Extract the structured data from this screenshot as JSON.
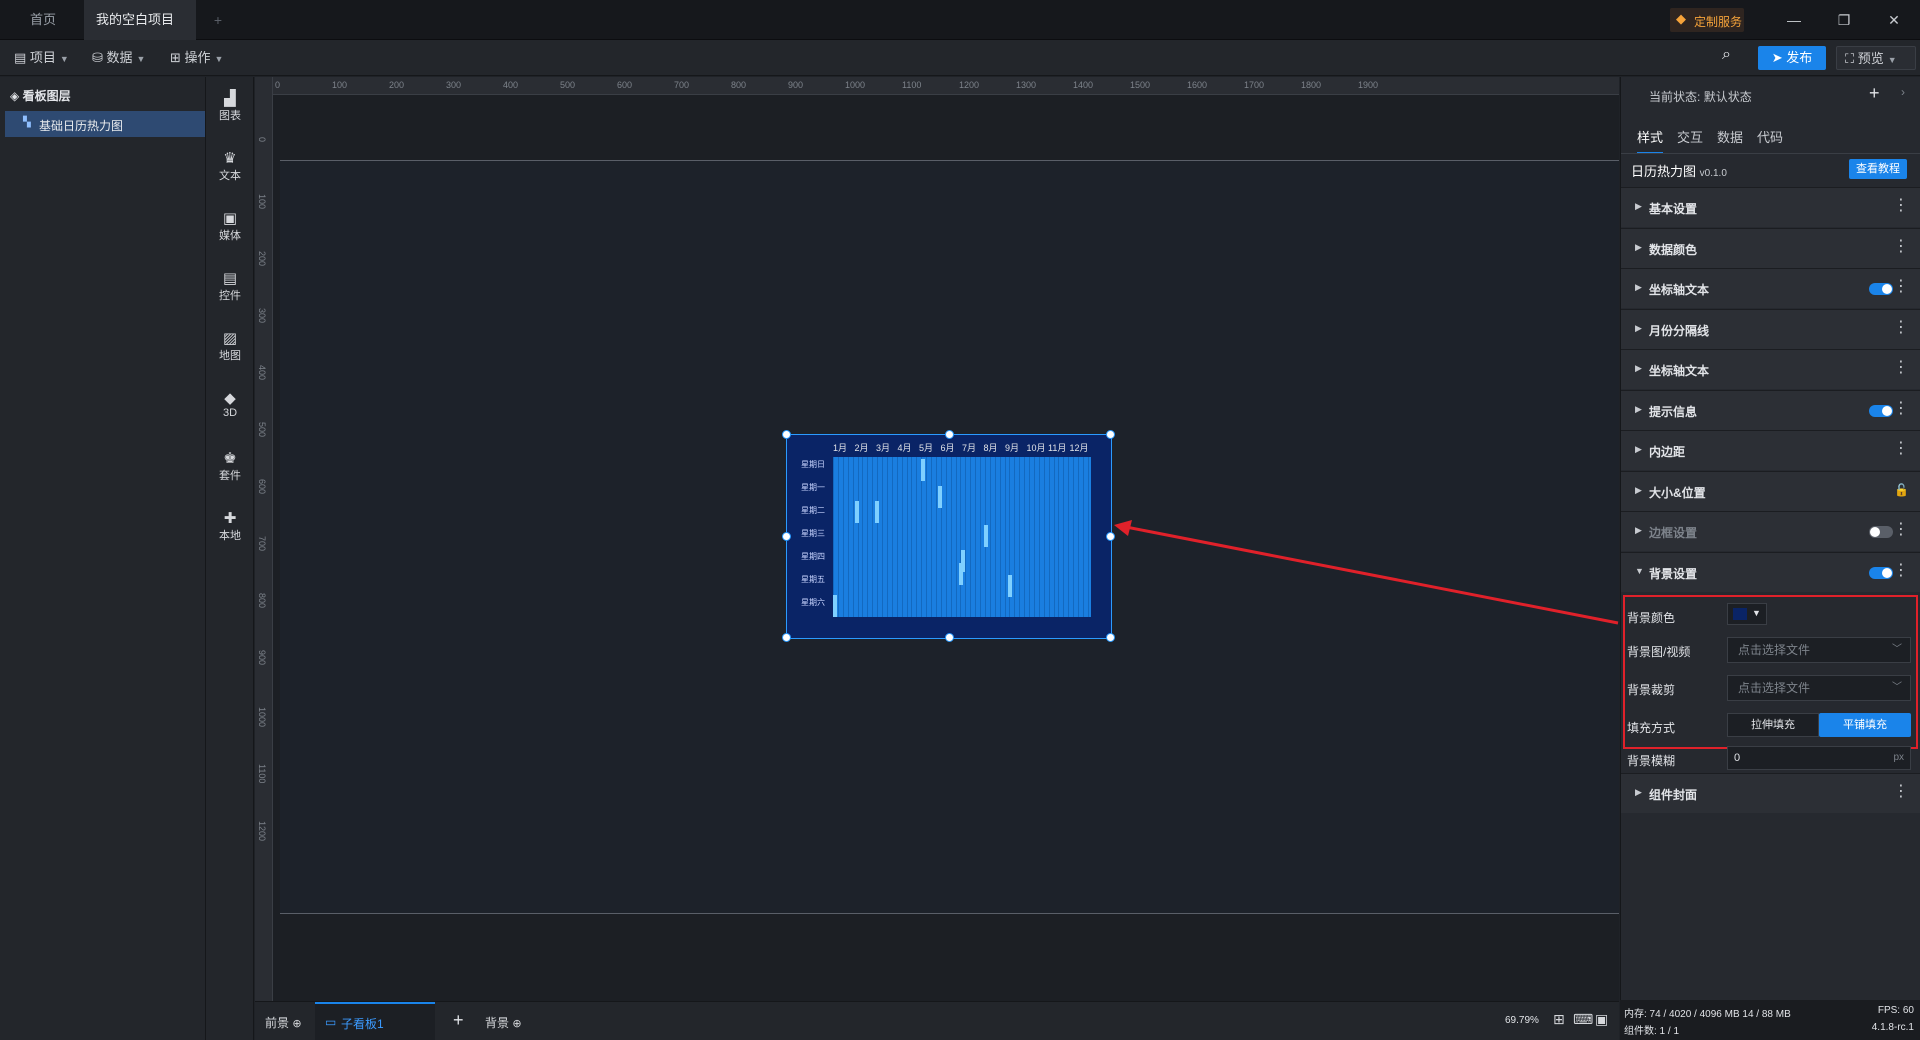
{
  "titlebar": {
    "tabs": [
      "首页",
      "我的空白项目"
    ],
    "custom_service": "定制服务"
  },
  "menubar": {
    "items": [
      "项目",
      "数据",
      "操作"
    ],
    "publish": "发布",
    "preview": "预览"
  },
  "layers": {
    "title": "看板图层",
    "items": [
      "基础日历热力图"
    ]
  },
  "tools": [
    "图表",
    "文本",
    "媒体",
    "控件",
    "地图",
    "3D",
    "套件",
    "本地"
  ],
  "ruler_top": [
    "0",
    "100",
    "200",
    "300",
    "400",
    "500",
    "600",
    "700",
    "800",
    "900",
    "1000",
    "1100",
    "1200",
    "1300",
    "1400",
    "1500",
    "1600",
    "1700",
    "1800",
    "1900"
  ],
  "ruler_left": [
    "0",
    "100",
    "200",
    "300",
    "400",
    "500",
    "600",
    "700",
    "800",
    "900",
    "1000",
    "1100",
    "1200"
  ],
  "widget": {
    "months": [
      "1月",
      "2月",
      "3月",
      "4月",
      "5月",
      "6月",
      "7月",
      "8月",
      "9月",
      "10月",
      "11月",
      "12月"
    ],
    "weekdays": [
      "星期日",
      "星期一",
      "星期二",
      "星期三",
      "星期四",
      "星期五",
      "星期六"
    ]
  },
  "bottombar": {
    "tabs": [
      "前景",
      "子看板1",
      "背景"
    ],
    "zoom": "69.79%"
  },
  "rightpanel": {
    "state_label": "当前状态:",
    "state_value": "默认状态",
    "tabs": [
      "样式",
      "交互",
      "数据",
      "代码"
    ],
    "component_name": "日历热力图",
    "version": "v0.1.0",
    "tutorial": "查看教程",
    "sections": [
      {
        "label": "基本设置",
        "toggle": "none"
      },
      {
        "label": "数据颜色",
        "toggle": "none"
      },
      {
        "label": "坐标轴文本",
        "toggle": "on"
      },
      {
        "label": "月份分隔线",
        "toggle": "none"
      },
      {
        "label": "坐标轴文本",
        "toggle": "none"
      },
      {
        "label": "提示信息",
        "toggle": "on"
      },
      {
        "label": "内边距",
        "toggle": "none"
      },
      {
        "label": "大小&位置",
        "toggle": "lock"
      },
      {
        "label": "边框设置",
        "toggle": "off"
      },
      {
        "label": "背景设置",
        "toggle": "on"
      }
    ],
    "bg": {
      "color_label": "背景颜色",
      "color_value": "#0a2466",
      "image_label": "背景图/视频",
      "image_placeholder": "点击选择文件",
      "crop_label": "背景裁剪",
      "crop_placeholder": "点击选择文件",
      "fill_label": "填充方式",
      "fill_options": [
        "拉伸填充",
        "平铺填充"
      ],
      "fill_selected": "平铺填充",
      "blur_label": "背景模糊",
      "blur_value": "0",
      "blur_unit": "px"
    },
    "cover": "组件封面"
  },
  "status": {
    "memory": "内存: 74 / 4020 / 4096 MB  14 / 88 MB",
    "fps": "FPS: 60",
    "components": "组件数: 1 / 1",
    "version": "4.1.8-rc.1"
  },
  "colors": {
    "accent": "#1a84ea",
    "widget_bg": "#0a2466",
    "cell": "#1a7ee0",
    "highlight_box": "#e0212a",
    "arrow": "#e0212a"
  }
}
